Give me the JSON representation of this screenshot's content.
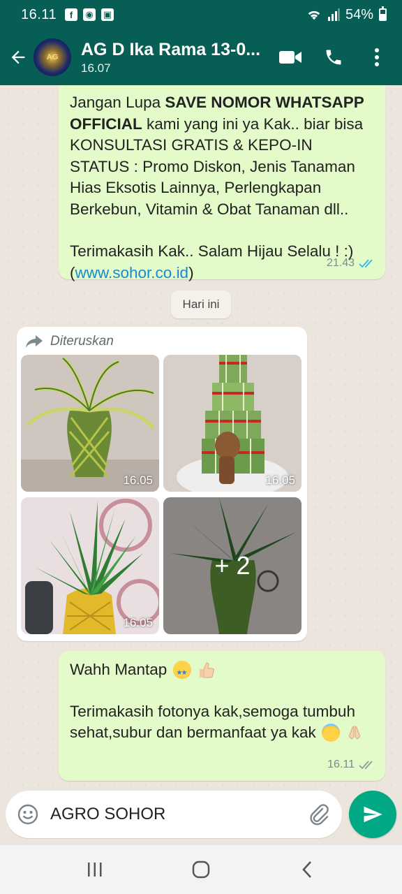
{
  "status_bar": {
    "time": "16.11",
    "notification_icons": [
      "facebook-icon",
      "messenger-icon",
      "gallery-icon"
    ],
    "battery": "54%"
  },
  "header": {
    "contact_name": "AG D Ika Rama 13-0...",
    "subtitle": "16.07",
    "avatar_text": "AG",
    "actions": [
      "video-call-icon",
      "voice-call-icon",
      "more-options-icon"
    ]
  },
  "messages": [
    {
      "type": "outgoing-text",
      "text_plain_1": "Jangan Lupa ",
      "text_bold": "SAVE NOMOR WHATSAPP OFFICIAL",
      "text_plain_2": " kami yang ini ya Kak.. biar bisa KONSULTASI GRATIS & KEPO-IN STATUS : Promo Diskon, Jenis Tanaman Hias Eksotis Lainnya, Perlengkapan Berkebun, Vitamin & Obat Tanaman dll..",
      "text_thanks": "Terimakasih Kak.. Salam Hijau Selalu ! :)",
      "link_open": "(",
      "link": "www.sohor.co.id",
      "link_close": ")",
      "time": "21.43",
      "status": "read"
    },
    {
      "type": "date-chip",
      "label": "Hari ini"
    },
    {
      "type": "incoming-album",
      "forwarded_label": "Diteruskan",
      "photos": [
        {
          "time": "16.05",
          "subject": "braided lucky bamboo vase"
        },
        {
          "time": "16.05",
          "subject": "tiered lucky bamboo tower with figurine"
        },
        {
          "time": "16.05",
          "subject": "dracaena in yellow pineapple pot"
        },
        {
          "time": "",
          "subject": "bamboo plant",
          "more_count": "+ 2"
        }
      ]
    },
    {
      "type": "outgoing-text",
      "line1": "Wahh Mantap",
      "line2": "Terimakasih fotonya kak,semoga tumbuh sehat,subur dan bermanfaat ya kak",
      "emojis": [
        "star-struck-emoji",
        "thumbs-up-emoji",
        "smiling-halo-emoji",
        "folded-hands-emoji"
      ],
      "time": "16.11",
      "status": "delivered"
    }
  ],
  "composer": {
    "value": "AGRO SOHOR",
    "icons": [
      "emoji-icon",
      "attach-icon"
    ],
    "send_icon": "send-icon"
  },
  "nav_bar": [
    "recent-apps-icon",
    "home-icon",
    "back-icon"
  ],
  "colors": {
    "header": "#075e54",
    "outgoing_bubble": "#e2fbc9",
    "incoming_bubble": "#ffffff",
    "chat_bg": "#ece5dd",
    "send_button": "#00a884",
    "read_ticks": "#34b7f1",
    "link": "#1a8ad0"
  }
}
